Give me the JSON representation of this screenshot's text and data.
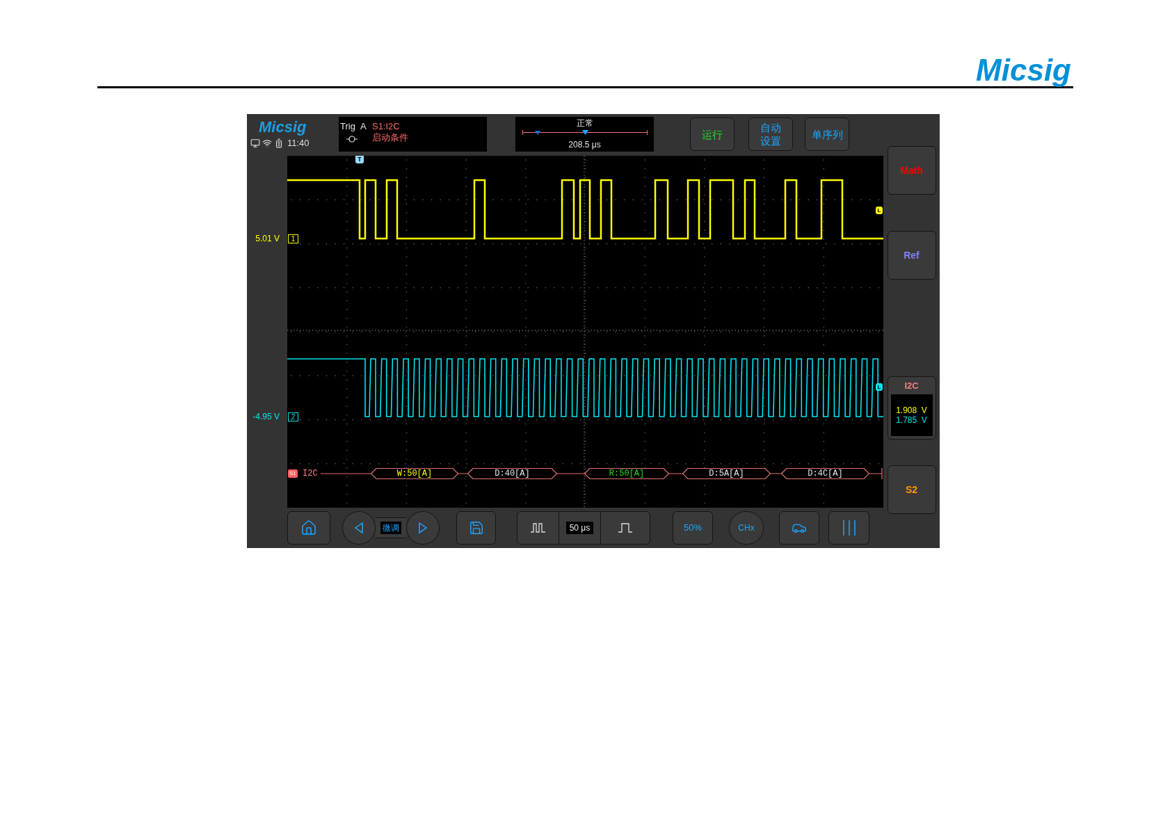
{
  "header": {
    "logo": "Micsig"
  },
  "screen": {
    "logo": "Micsig",
    "time": "11:40",
    "trigger": {
      "label": "Trig",
      "slot": "A",
      "source": "S1:I2C",
      "condition": "启动条件"
    },
    "timebase": {
      "mode": "正常",
      "level": 0.5,
      "delay": "208.5 μs"
    },
    "buttons": [
      {
        "lines": [
          "运行"
        ],
        "color": "#22dd22"
      },
      {
        "lines": [
          "自动",
          "设置"
        ],
        "color": "#1ea7ff"
      },
      {
        "lines": [
          "单序列"
        ],
        "color": "#1ea7ff"
      }
    ],
    "trigger_marker": "T",
    "channels": [
      {
        "name": "1",
        "offset": "5.01 V",
        "color": "#ffff00",
        "level_marker": "L"
      },
      {
        "name": "2",
        "offset": "-4.95 V",
        "color": "#00e5ee",
        "level_marker": "L"
      }
    ],
    "decode": {
      "source": "S1",
      "protocol": "I2C",
      "packets": [
        {
          "text": "W:50[A]",
          "color": "#ffff00"
        },
        {
          "text": "D:40[A]",
          "color": "#e5e5e5"
        },
        {
          "text": "R:50[A]",
          "color": "#22dd22"
        },
        {
          "text": "D:5A[A]",
          "color": "#e5e5e5"
        },
        {
          "text": "D:4C[A]",
          "color": "#e5e5e5"
        }
      ]
    },
    "side_buttons": [
      {
        "kind": "button",
        "label": "Math",
        "color": "#ff0000"
      },
      {
        "kind": "button",
        "label": "Ref",
        "color": "#8080ff"
      },
      {
        "kind": "readout",
        "label": "I2C",
        "color": "#f08080",
        "readings": [
          {
            "text": "1.908  V",
            "color": "#ffff00"
          },
          {
            "text": "1.785  V",
            "color": "#00e5ee"
          }
        ]
      },
      {
        "kind": "button",
        "label": "S2",
        "color": "#ff9900"
      }
    ],
    "toolbar": {
      "fine": "微调",
      "timebase": "50 μs",
      "trigger_level": "50%",
      "channel": "CHx"
    }
  }
}
